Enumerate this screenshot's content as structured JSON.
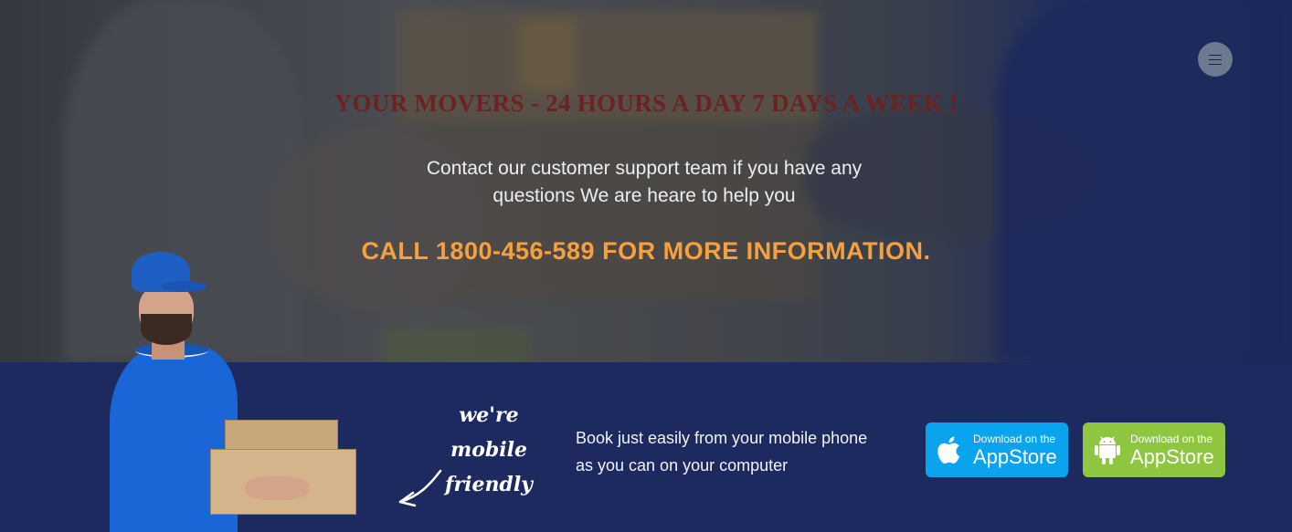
{
  "hero": {
    "headline": "YOUR MOVERS - 24 HOURS A DAY 7 DAYS A WEEK !",
    "subtext": "Contact our customer support team if you have any questions We are heare to help you",
    "cta": "CALL 1800-456-589 FOR MORE INFORMATION.",
    "menu_icon": "hamburger-menu-icon"
  },
  "band": {
    "tagline_lines": [
      "we're",
      "mobile",
      "friendly"
    ],
    "description": "Book just easily from your mobile phone as you can on your computer",
    "buttons": [
      {
        "small": "Download on the",
        "big": "AppStore",
        "icon": "apple-icon",
        "color": "#0aa4ee"
      },
      {
        "small": "Download on the",
        "big": "AppStore",
        "icon": "android-icon",
        "color": "#8ec63f"
      }
    ]
  },
  "colors": {
    "band_background": "#1d2a5f",
    "headline": "#6a2320",
    "cta": "#f7a13e"
  }
}
